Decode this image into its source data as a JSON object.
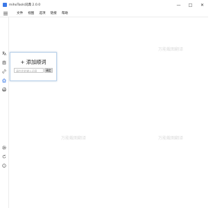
{
  "window": {
    "title": "mihoTools词典 2.0.0",
    "controls": [
      "—",
      "□",
      "✕"
    ]
  },
  "menu": {
    "items": [
      "文件",
      "视图",
      "选项",
      "链接",
      "帮助"
    ]
  },
  "sidebar": {
    "icons": [
      "translate-icon",
      "character-icon",
      "link-icon",
      "home-icon",
      "print-icon",
      "settings-icon",
      "reload-icon",
      "info-icon"
    ]
  },
  "watermark": {
    "text": "万能截图翻译"
  },
  "popup": {
    "title": "+ 添加顺词",
    "input_placeholder": "请在此处输入词语",
    "ok_label": "确定"
  },
  "colors": {
    "accent": "#3b78e7",
    "popup_border": "#b9d1ea"
  }
}
